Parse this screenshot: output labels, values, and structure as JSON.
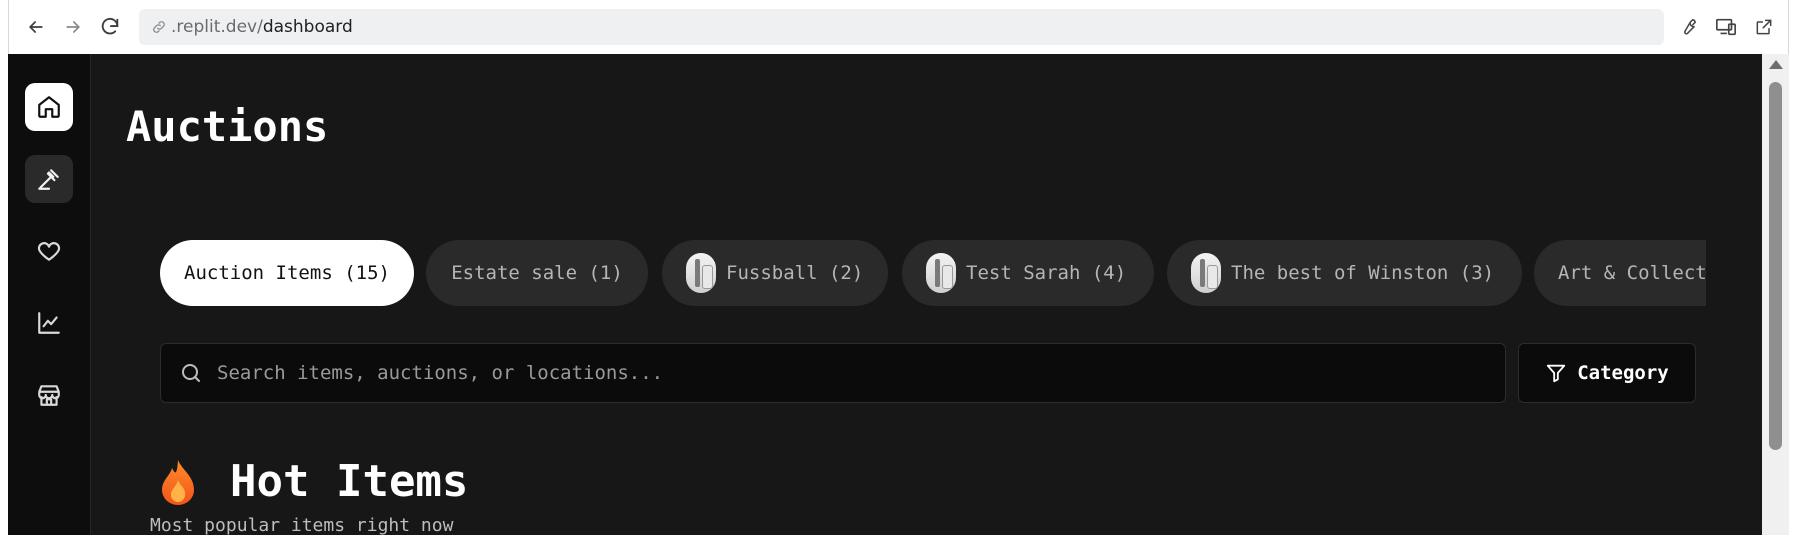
{
  "browser": {
    "url_prefix": ".replit.dev/",
    "url_path": "dashboard"
  },
  "sidebar": {
    "items": [
      {
        "name": "home",
        "icon": "home-icon"
      },
      {
        "name": "auctions",
        "icon": "gavel-icon"
      },
      {
        "name": "favorites",
        "icon": "heart-icon"
      },
      {
        "name": "analytics",
        "icon": "chart-icon"
      },
      {
        "name": "store",
        "icon": "store-icon"
      }
    ]
  },
  "page": {
    "title": "Auctions"
  },
  "tabs": [
    {
      "label": "Auction Items (15)",
      "active": true
    },
    {
      "label": "Estate sale (1)"
    },
    {
      "label": "Fussball (2)"
    },
    {
      "label": "Test Sarah (4)"
    },
    {
      "label": "The best of Winston (3)"
    },
    {
      "label": "Art & Collect"
    }
  ],
  "search": {
    "placeholder": "Search items, auctions, or locations...",
    "value": ""
  },
  "filter": {
    "category_label": "Category"
  },
  "section": {
    "title": "Hot Items",
    "subtitle": "Most popular items right now",
    "icon": "flame-icon"
  },
  "colors": {
    "background": "#171717",
    "sidebar": "#0d0d0d",
    "tab_inactive": "#2a2a2a",
    "tab_active": "#ffffff"
  }
}
